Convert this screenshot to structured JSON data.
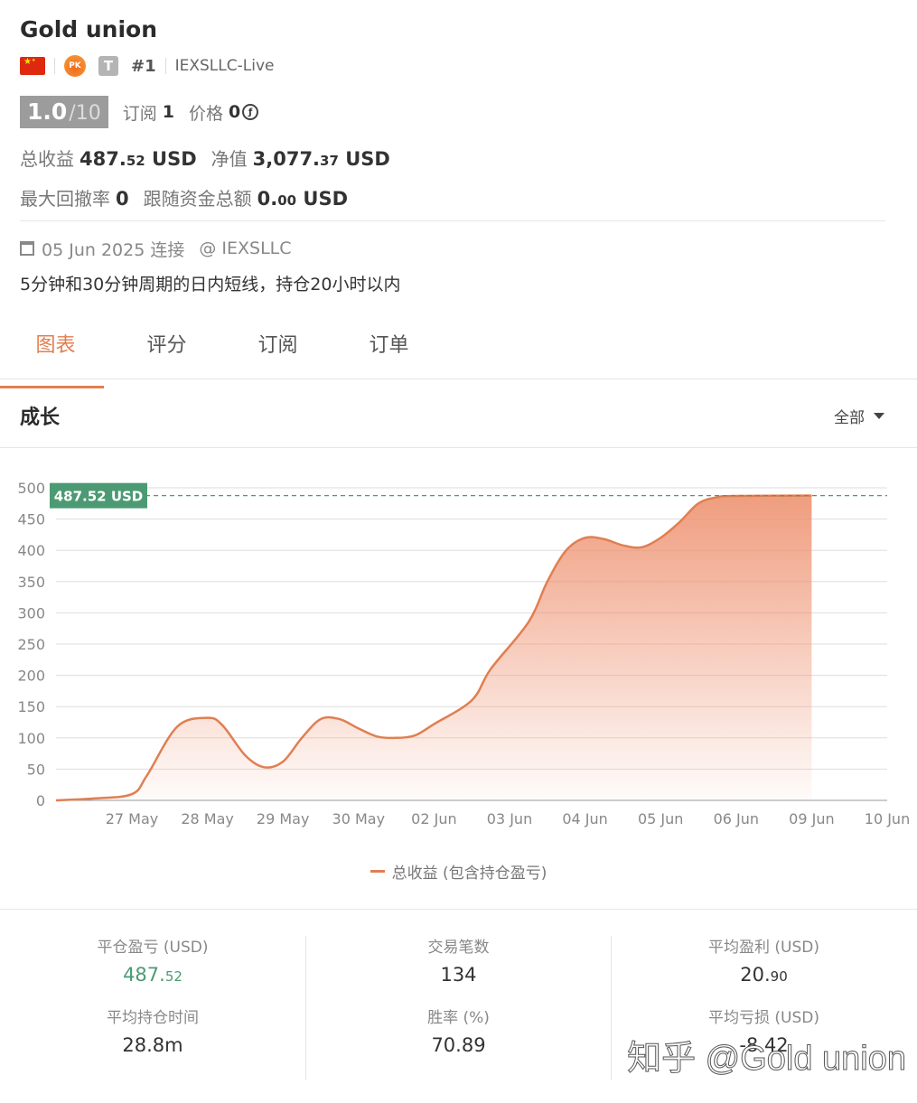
{
  "header": {
    "title": "Gold union",
    "flag_country": "CN",
    "pk_badge": "PK",
    "type_badge": "T",
    "rank": "#1",
    "server": "IEXSLLC-Live"
  },
  "score": {
    "value": "1.0",
    "max": "/10",
    "subscribe_label": "订阅",
    "subscribe_value": "1",
    "price_label": "价格",
    "price_value": "0",
    "price_icon": "coin-icon"
  },
  "totals": {
    "total_profit_label": "总收益",
    "total_profit_int": "487.",
    "total_profit_dec": "52",
    "total_profit_unit": "USD",
    "equity_label": "净值",
    "equity_int": "3,077.",
    "equity_dec": "37",
    "equity_unit": "USD",
    "max_drawdown_label": "最大回撤率",
    "max_drawdown_value": "0",
    "follow_funds_label": "跟随资金总额",
    "follow_funds_int": "0.",
    "follow_funds_dec": "00",
    "follow_funds_unit": "USD"
  },
  "info": {
    "date": "05 Jun 2025 连接",
    "broker": "@ IEXSLLC",
    "description": "5分钟和30分钟周期的日内短线，持仓20小时以内"
  },
  "tabs": [
    {
      "label": "图表",
      "active": true
    },
    {
      "label": "评分",
      "active": false
    },
    {
      "label": "订阅",
      "active": false
    },
    {
      "label": "订单",
      "active": false
    }
  ],
  "growth": {
    "title": "成长",
    "range": "全部"
  },
  "chart_data": {
    "type": "area",
    "x": [
      "27 May",
      "28 May",
      "29 May",
      "30 May",
      "02 Jun",
      "03 Jun",
      "04 Jun",
      "05 Jun",
      "06 Jun",
      "09 Jun",
      "10 Jun"
    ],
    "series": [
      {
        "name": "总收益 (包含持仓盈亏)",
        "points": [
          [
            0,
            0
          ],
          [
            0.5,
            3
          ],
          [
            1.0,
            10
          ],
          [
            1.2,
            40
          ],
          [
            1.6,
            118
          ],
          [
            2.0,
            132
          ],
          [
            2.2,
            120
          ],
          [
            2.5,
            72
          ],
          [
            2.75,
            53
          ],
          [
            3.0,
            62
          ],
          [
            3.25,
            100
          ],
          [
            3.5,
            130
          ],
          [
            3.75,
            130
          ],
          [
            4.0,
            115
          ],
          [
            4.25,
            102
          ],
          [
            4.5,
            100
          ],
          [
            4.75,
            104
          ],
          [
            5.0,
            122
          ],
          [
            5.5,
            160
          ],
          [
            5.75,
            210
          ],
          [
            6.25,
            285
          ],
          [
            6.5,
            350
          ],
          [
            6.75,
            400
          ],
          [
            7.0,
            420
          ],
          [
            7.25,
            418
          ],
          [
            7.5,
            408
          ],
          [
            7.75,
            405
          ],
          [
            8.0,
            420
          ],
          [
            8.25,
            445
          ],
          [
            8.5,
            475
          ],
          [
            8.75,
            485
          ],
          [
            9.0,
            487
          ],
          [
            10.0,
            487.52
          ]
        ]
      }
    ],
    "x_index_note": "",
    "ylim": [
      0,
      500
    ],
    "yticks": [
      0,
      50,
      100,
      150,
      200,
      250,
      300,
      350,
      400,
      450,
      500
    ],
    "current_label": "487.52 USD",
    "current_value": 487.52,
    "line_color": "#e07f52",
    "marker_color": "#4c9a73",
    "grid": true,
    "legend_position": "bottom"
  },
  "stats": {
    "closed_pl_label": "平仓盈亏 (USD)",
    "closed_pl_int": "487.",
    "closed_pl_dec": "52",
    "trades_label": "交易笔数",
    "trades_value": "134",
    "avg_profit_label": "平均盈利 (USD)",
    "avg_profit_int": "20.",
    "avg_profit_dec": "90",
    "avg_hold_label": "平均持仓时间",
    "avg_hold_value": "28.8m",
    "win_rate_label": "胜率 (%)",
    "win_rate_value": "70.89",
    "avg_loss_label": "平均亏损 (USD)",
    "avg_loss_value": "-8.42"
  },
  "watermark": "知乎 @Gold union",
  "colors": {
    "accent": "#e07f52",
    "positive": "#4c9a73"
  }
}
